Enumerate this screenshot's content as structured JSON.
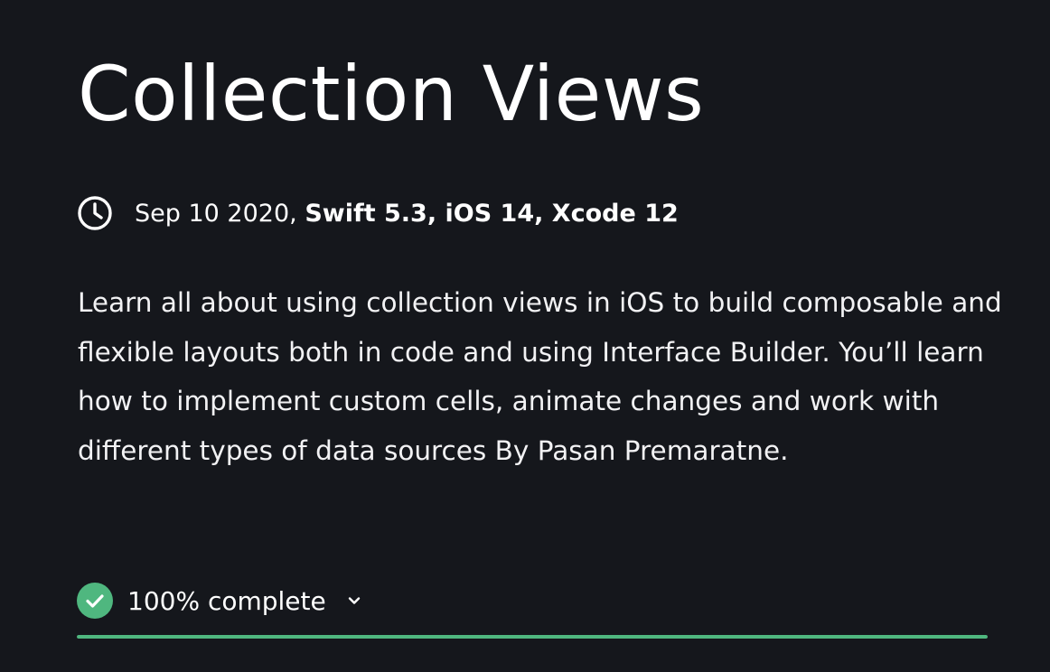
{
  "course": {
    "title": "Collection Views",
    "meta": {
      "icon": "clock-icon",
      "date": "Sep 10 2020,",
      "platforms": "Swift 5.3, iOS 14, Xcode 12"
    },
    "description": "Learn all about using collection views in iOS to build composable and flexible layouts both in code and using Interface Builder. You’ll learn how to implement custom cells, animate changes and work with different types of data sources By Pasan Premaratne."
  },
  "progress": {
    "label": "100% complete",
    "fraction": 1.0,
    "icon": "check-circle-icon",
    "toggle_icon": "chevron-down-icon"
  },
  "colors": {
    "background": "#15171c",
    "text": "#ffffff",
    "success": "#4fb77f"
  }
}
